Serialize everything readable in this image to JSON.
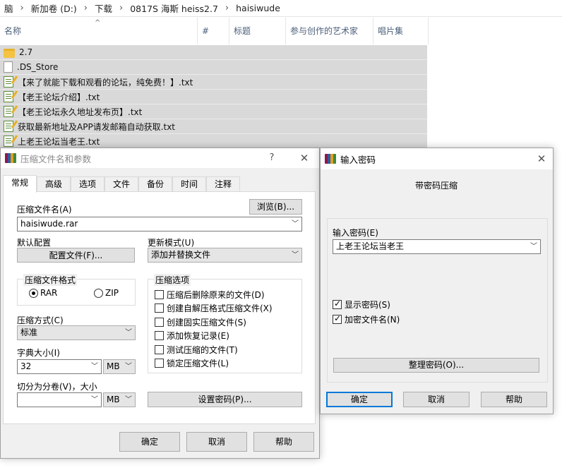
{
  "explorer": {
    "breadcrumb": [
      "脑",
      "新加卷 (D:)",
      "下载",
      "0817S 海斯 heiss2.7",
      "haisiwude"
    ],
    "columns": [
      "名称",
      "#",
      "标题",
      "参与创作的艺术家",
      "唱片集"
    ],
    "files": [
      {
        "name": "2.7",
        "icon": "folder-icon"
      },
      {
        "name": ".DS_Store",
        "icon": "file-icon"
      },
      {
        "name": "【来了就能下载和观看的论坛，纯免费！】.txt",
        "icon": "text-file-icon"
      },
      {
        "name": "【老王论坛介绍】.txt",
        "icon": "text-file-icon"
      },
      {
        "name": "【老王论坛永久地址发布页】.txt",
        "icon": "text-file-icon"
      },
      {
        "name": "获取最新地址及APP请发邮箱自动获取.txt",
        "icon": "text-file-icon"
      },
      {
        "name": "上老王论坛当老王.txt",
        "icon": "text-file-icon"
      }
    ]
  },
  "archive_dialog": {
    "title": "压缩文件名和参数",
    "help_glyph": "?",
    "close_glyph": "✕",
    "tabs": [
      "常规",
      "高级",
      "选项",
      "文件",
      "备份",
      "时间",
      "注释"
    ],
    "archive_name_label": "压缩文件名(A)",
    "browse_button": "浏览(B)...",
    "archive_name_value": "haisiwude.rar",
    "default_profile_label": "默认配置",
    "profiles_button": "配置文件(F)...",
    "update_mode_label": "更新模式(U)",
    "update_mode_value": "添加并替换文件",
    "format_group": "压缩文件格式",
    "format_rar": "RAR",
    "format_zip": "ZIP",
    "method_label": "压缩方式(C)",
    "method_value": "标准",
    "dict_label": "字典大小(I)",
    "dict_value": "32",
    "dict_unit": "MB",
    "split_label": "切分为分卷(V)，大小",
    "split_value": "",
    "split_unit": "MB",
    "options_group": "压缩选项",
    "options": [
      {
        "label": "压缩后删除原来的文件(D)",
        "checked": false
      },
      {
        "label": "创建自解压格式压缩文件(X)",
        "checked": false
      },
      {
        "label": "创建固实压缩文件(S)",
        "checked": false
      },
      {
        "label": "添加恢复记录(E)",
        "checked": false
      },
      {
        "label": "测试压缩的文件(T)",
        "checked": false
      },
      {
        "label": "锁定压缩文件(L)",
        "checked": false
      }
    ],
    "set_password_button": "设置密码(P)...",
    "ok_button": "确定",
    "cancel_button": "取消",
    "help_button": "帮助"
  },
  "password_dialog": {
    "title": "输入密码",
    "close_glyph": "✕",
    "heading": "带密码压缩",
    "password_label": "输入密码(E)",
    "password_value": "上老王论坛当老王",
    "show_password": {
      "label": "显示密码(S)",
      "checked": true
    },
    "encrypt_names": {
      "label": "加密文件名(N)",
      "checked": true
    },
    "organize_button": "整理密码(O)...",
    "ok_button": "确定",
    "cancel_button": "取消",
    "help_button": "帮助"
  },
  "colors": {
    "accent": "#0078d7",
    "selection": "#d9d9d9",
    "dialog_bg": "#f0f0f0"
  }
}
